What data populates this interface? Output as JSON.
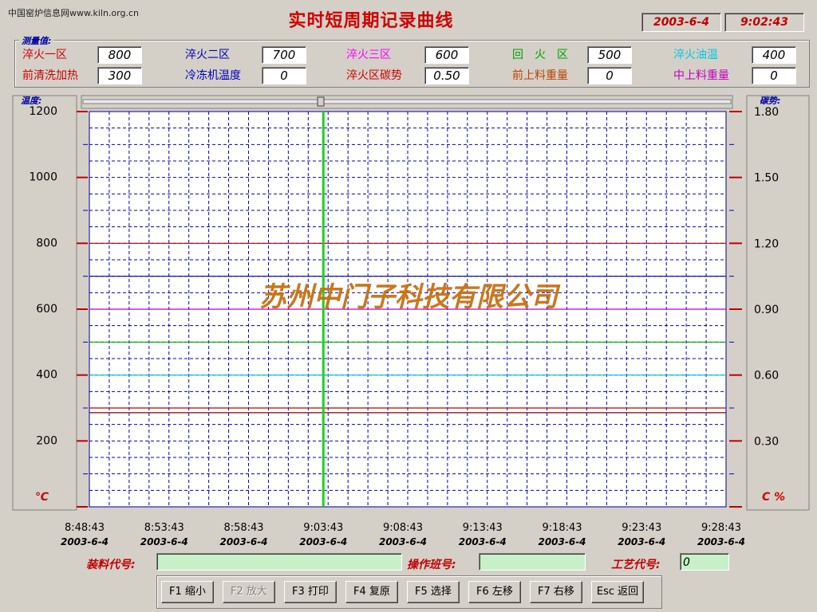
{
  "watermark": "中国窑炉信息网www.kiln.org.cn",
  "title": "实时短周期记录曲线",
  "datetime": {
    "date": "2003-6-4",
    "time": "9:02:43"
  },
  "measurements": {
    "legend": "测量值:",
    "items": [
      {
        "label": "淬火一区",
        "value": "800",
        "color": "#d00000"
      },
      {
        "label": "淬火二区",
        "value": "700",
        "color": "#0000c0"
      },
      {
        "label": "淬火三区",
        "value": "600",
        "color": "#ff00ff"
      },
      {
        "label": "回　火　区",
        "value": "500",
        "color": "#00a000"
      },
      {
        "label": "淬火油温",
        "value": "400",
        "color": "#00c8e0"
      },
      {
        "label": "前清洗加热",
        "value": "300",
        "color": "#d00000"
      },
      {
        "label": "冷冻机温度",
        "value": "0",
        "color": "#0000c0"
      },
      {
        "label": "淬火区碳势",
        "value": "0.50",
        "color": "#d00000"
      },
      {
        "label": "前上料重量",
        "value": "0",
        "color": "#c04000"
      },
      {
        "label": "中上料重量",
        "value": "0",
        "color": "#c000c0"
      }
    ]
  },
  "chart": {
    "left_axis_title": "温度:",
    "right_axis_title": "碳势:",
    "left_unit": "℃",
    "right_unit": "C %",
    "company_watermark": "苏州中门子科技有限公司",
    "left_ticks": [
      "1200",
      "1000",
      "800",
      "600",
      "400",
      "200"
    ],
    "right_ticks": [
      "1.80",
      "1.50",
      "1.20",
      "0.90",
      "0.60",
      "0.30"
    ],
    "x_ticks": [
      {
        "time": "8:48:43",
        "date": "2003-6-4"
      },
      {
        "time": "8:53:43",
        "date": "2003-6-4"
      },
      {
        "time": "8:58:43",
        "date": "2003-6-4"
      },
      {
        "time": "9:03:43",
        "date": "2003-6-4"
      },
      {
        "time": "9:08:43",
        "date": "2003-6-4"
      },
      {
        "time": "9:13:43",
        "date": "2003-6-4"
      },
      {
        "time": "9:18:43",
        "date": "2003-6-4"
      },
      {
        "time": "9:23:43",
        "date": "2003-6-4"
      },
      {
        "time": "9:28:43",
        "date": "2003-6-4"
      }
    ]
  },
  "chart_data": {
    "type": "line",
    "x_range": [
      "8:48:43",
      "9:28:43"
    ],
    "ylim": [
      0,
      1200
    ],
    "y2lim": [
      0,
      2.1
    ],
    "current_time_marker": "9:03:43",
    "grid": true,
    "series": [
      {
        "name": "淬火一区",
        "value": 800,
        "color": "#c00000"
      },
      {
        "name": "淬火二区",
        "value": 700,
        "color": "#0000a0"
      },
      {
        "name": "淬火三区",
        "value": 600,
        "color": "#c000c0"
      },
      {
        "name": "回　火　区",
        "value": 500,
        "color": "#00b000"
      },
      {
        "name": "淬火油温",
        "value": 400,
        "color": "#00c0e0"
      },
      {
        "name": "前清洗加热",
        "value": 300,
        "color": "#c00000"
      },
      {
        "name": "淬火区碳势",
        "value": 0.5,
        "axis": "right",
        "color": "#800000"
      }
    ]
  },
  "bottom": {
    "load_code_label": "装料代号:",
    "load_code_value": "",
    "shift_label": "操作班号:",
    "shift_value": "",
    "process_label": "工艺代号:",
    "process_value": "0"
  },
  "fkeys": [
    {
      "label": "F1 缩小",
      "disabled": false
    },
    {
      "label": "F2 放大",
      "disabled": true
    },
    {
      "label": "F3 打印",
      "disabled": false
    },
    {
      "label": "F4 复原",
      "disabled": false
    },
    {
      "label": "F5 选择",
      "disabled": false
    },
    {
      "label": "F6 左移",
      "disabled": false
    },
    {
      "label": "F7 右移",
      "disabled": false
    },
    {
      "label": "Esc 返回",
      "disabled": false
    }
  ]
}
